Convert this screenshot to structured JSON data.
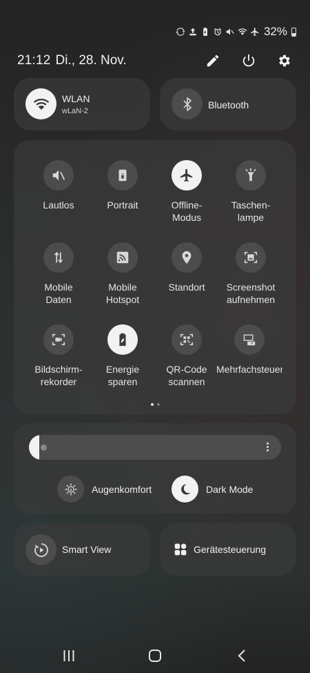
{
  "status_bar": {
    "icons": [
      "sync-icon",
      "upload-icon",
      "battery-saver-icon",
      "alarm-icon",
      "mute-icon",
      "wifi-icon",
      "airplane-icon"
    ],
    "battery": "32%"
  },
  "header": {
    "time": "21:12",
    "date": "Di., 28. Nov.",
    "icons": [
      "pencil-icon",
      "power-icon",
      "gear-icon"
    ]
  },
  "wifi": {
    "title": "WLAN",
    "network": "wLaN-2",
    "on": true
  },
  "bluetooth": {
    "title": "Bluetooth",
    "on": false
  },
  "quick_settings": [
    {
      "label": "Lautlos",
      "icon": "mute-icon",
      "on": false
    },
    {
      "label": "Portrait",
      "icon": "rotation-lock-icon",
      "on": false
    },
    {
      "label": "Offline-\nModus",
      "icon": "airplane-icon",
      "on": true
    },
    {
      "label": "Taschen-\nlampe",
      "icon": "flashlight-icon",
      "on": false
    },
    {
      "label": "Mobile\nDaten",
      "icon": "mobile-data-icon",
      "on": false
    },
    {
      "label": "Mobile\nHotspot",
      "icon": "hotspot-icon",
      "on": false
    },
    {
      "label": "Standort",
      "icon": "location-icon",
      "on": false
    },
    {
      "label": "Screenshot\naufnehmen",
      "icon": "screenshot-icon",
      "on": false
    },
    {
      "label": "Bildschirm-\nrekorder",
      "icon": "screen-recorder-icon",
      "on": false
    },
    {
      "label": "Energie\nsparen",
      "icon": "power-saving-icon",
      "on": true
    },
    {
      "label": "QR-Code\nscannen",
      "icon": "qr-scanner-icon",
      "on": false
    },
    {
      "label": "Mehrfachsteuerung",
      "icon": "multi-control-icon",
      "on": false
    }
  ],
  "page_indicator": {
    "pages": 2,
    "current": 1
  },
  "brightness": {
    "level": 0.04
  },
  "eye_comfort": {
    "label": "Augenkomfort",
    "on": false
  },
  "dark_mode": {
    "label": "Dark Mode",
    "on": true
  },
  "smart_view": {
    "label": "Smart View"
  },
  "device_control": {
    "label": "Gerätesteuerung"
  },
  "nav_bar": {
    "icons": [
      "recents-icon",
      "home-icon",
      "back-icon"
    ]
  },
  "colors": {
    "tile_on": "#f2f2f2",
    "tile_off": "#4c4c4c",
    "card": "#3a3a3a"
  }
}
